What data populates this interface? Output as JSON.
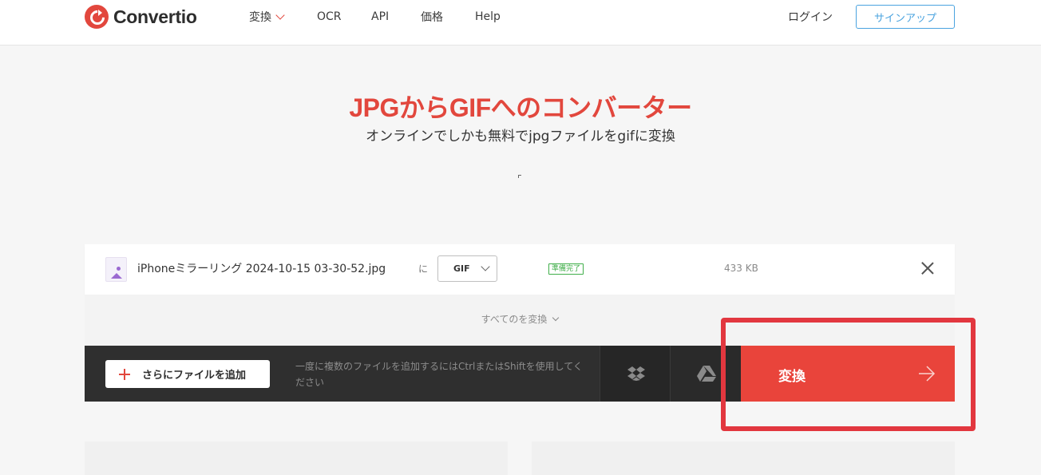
{
  "header": {
    "logo_text": "Convertio",
    "nav": [
      {
        "label": "変換"
      },
      {
        "label": "OCR"
      },
      {
        "label": "API"
      },
      {
        "label": "価格"
      },
      {
        "label": "Help"
      }
    ],
    "login": "ログイン",
    "signup": "サインアップ"
  },
  "hero": {
    "title": "JPGからGIFへのコンバーター",
    "subtitle": "オンラインでしかも無料でjpgファイルをgifに変換"
  },
  "file": {
    "name": "iPhoneミラーリング 2024-10-15 03-30-52.jpg",
    "to_label": "に",
    "format": "GIF",
    "status": "準備完了",
    "size": "433 KB"
  },
  "convert_all": {
    "label": "すべてのを変換"
  },
  "bar": {
    "add_files": "さらにファイルを追加",
    "hint": "一度に複数のファイルを追加するにはCtrlまたはShiftを使用してください",
    "convert": "変換"
  },
  "colors": {
    "accent": "#e2473d",
    "convert_button": "#e9443b",
    "link_blue": "#4aa3df",
    "ready_green": "#3fae49",
    "highlight": "#e2373f"
  },
  "icons": [
    "logo-icon",
    "chevron-down-icon",
    "image-file-icon",
    "close-icon",
    "plus-icon",
    "dropbox-icon",
    "google-drive-icon",
    "arrow-right-icon"
  ]
}
